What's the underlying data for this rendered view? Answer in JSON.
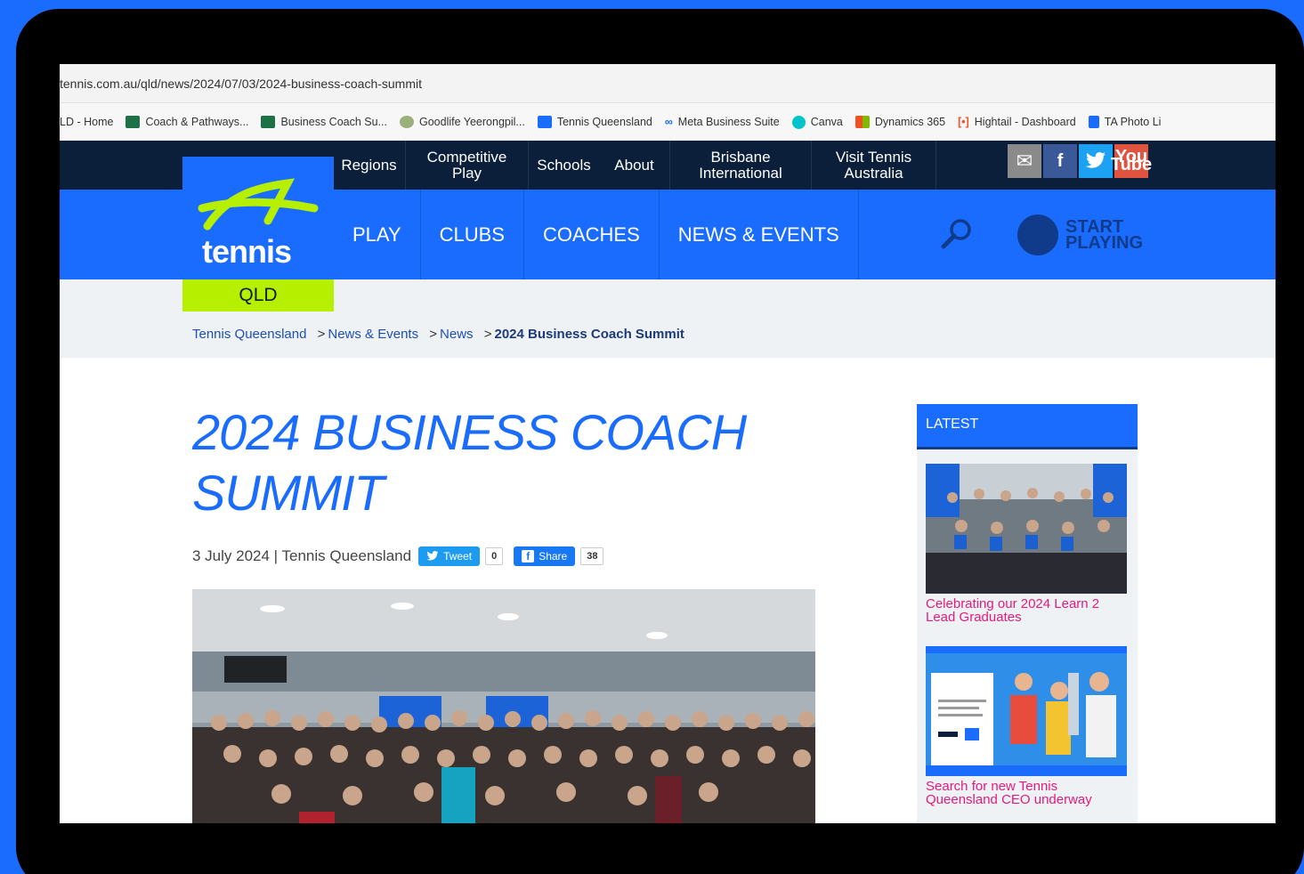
{
  "browser": {
    "url": "tennis.com.au/qld/news/2024/07/03/2024-business-coach-summit",
    "bookmarks": [
      {
        "label": "LD - Home",
        "icon": "none"
      },
      {
        "label": "Coach & Pathways...",
        "icon": "excel-icon"
      },
      {
        "label": "Business Coach Su...",
        "icon": "excel-icon"
      },
      {
        "label": "Goodlife Yeerongpil...",
        "icon": "goodlife-icon"
      },
      {
        "label": "Tennis Queensland",
        "icon": "tennis-icon"
      },
      {
        "label": "Meta Business Suite",
        "icon": "meta-icon"
      },
      {
        "label": "Canva",
        "icon": "canva-icon"
      },
      {
        "label": "Dynamics 365",
        "icon": "dynamics-icon"
      },
      {
        "label": "Hightail - Dashboard",
        "icon": "hightail-icon"
      },
      {
        "label": "TA Photo Li",
        "icon": "photo-icon"
      }
    ]
  },
  "topnav": {
    "regions": "Regions",
    "competitive_play": "Competitive Play",
    "schools": "Schools",
    "about": "About",
    "brisbane_international": "Brisbane International",
    "visit_tennis_australia": "Visit Tennis Australia"
  },
  "social": {
    "mail": "✉",
    "facebook": "f",
    "twitter": "🐦",
    "youtube": "You Tube"
  },
  "logo": {
    "word": "tennis",
    "region": "QLD"
  },
  "mainnav": {
    "play": "PLAY",
    "clubs": "CLUBS",
    "coaches": "COACHES",
    "news_events": "NEWS & EVENTS",
    "start_line1": "START",
    "start_line2": "PLAYING"
  },
  "breadcrumb": {
    "home": "Tennis Queensland",
    "sep": ">",
    "news_events": "News & Events",
    "news": "News",
    "current": "2024 Business Coach Summit"
  },
  "article": {
    "title": "2024 BUSINESS COACH SUMMIT",
    "date_author": "3 July 2024 | Tennis Queensland",
    "tweet_label": "Tweet",
    "tweet_count": "0",
    "share_label": "Share",
    "share_count": "38"
  },
  "sidebar": {
    "heading": "LATEST",
    "items": [
      {
        "title": "Celebrating our 2024 Learn 2 Lead Graduates"
      },
      {
        "title": "Search for new Tennis Queensland CEO underway"
      }
    ]
  },
  "colors": {
    "brand_blue": "#1a6cff",
    "navy": "#0b1f3a",
    "lime": "#b6f000",
    "link_pink": "#e8197a"
  }
}
